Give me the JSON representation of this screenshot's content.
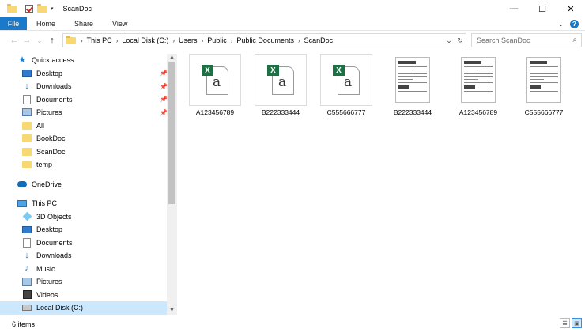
{
  "window": {
    "title": "ScanDoc",
    "controls": {
      "minimize": "—",
      "maximize": "☐",
      "close": "✕"
    }
  },
  "ribbon": {
    "file": "File",
    "tabs": [
      "Home",
      "Share",
      "View"
    ],
    "expand": "⌄",
    "help": "?"
  },
  "nav": {
    "back": "←",
    "forward": "→",
    "recent": "⌄",
    "up": "↑",
    "breadcrumb": [
      "This PC",
      "Local Disk (C:)",
      "Users",
      "Public",
      "Public Documents",
      "ScanDoc"
    ],
    "crumb_sep": "›",
    "dropdown": "⌄",
    "refresh": "↻"
  },
  "search": {
    "placeholder": "Search ScanDoc",
    "icon": "⌕"
  },
  "sidebar": {
    "quick_access": {
      "label": "Quick access",
      "items": [
        {
          "label": "Desktop",
          "icon": "desktop-icon",
          "pinned": true
        },
        {
          "label": "Downloads",
          "icon": "download-icon",
          "pinned": true
        },
        {
          "label": "Documents",
          "icon": "document-icon",
          "pinned": true
        },
        {
          "label": "Pictures",
          "icon": "pictures-icon",
          "pinned": true
        },
        {
          "label": "All",
          "icon": "folder-icon",
          "pinned": false
        },
        {
          "label": "BookDoc",
          "icon": "folder-icon",
          "pinned": false
        },
        {
          "label": "ScanDoc",
          "icon": "folder-icon",
          "pinned": false
        },
        {
          "label": "temp",
          "icon": "folder-icon",
          "pinned": false
        }
      ]
    },
    "onedrive": {
      "label": "OneDrive"
    },
    "this_pc": {
      "label": "This PC",
      "items": [
        {
          "label": "3D Objects",
          "icon": "cube-icon"
        },
        {
          "label": "Desktop",
          "icon": "desktop-icon"
        },
        {
          "label": "Documents",
          "icon": "document-icon"
        },
        {
          "label": "Downloads",
          "icon": "download-icon"
        },
        {
          "label": "Music",
          "icon": "music-icon"
        },
        {
          "label": "Pictures",
          "icon": "pictures-icon"
        },
        {
          "label": "Videos",
          "icon": "video-icon"
        },
        {
          "label": "Local Disk (C:)",
          "icon": "disk-icon",
          "selected": true
        }
      ]
    },
    "pin_glyph": "📌",
    "scroll_up": "▲",
    "scroll_down": "▼"
  },
  "files": [
    {
      "name": "A123456789",
      "type": "excel"
    },
    {
      "name": "B222333444",
      "type": "excel"
    },
    {
      "name": "C555666777",
      "type": "excel"
    },
    {
      "name": "B222333444",
      "type": "scan"
    },
    {
      "name": "A123456789",
      "type": "scan"
    },
    {
      "name": "C555666777",
      "type": "scan"
    }
  ],
  "excel_icon": {
    "badge": "X",
    "letter": "a"
  },
  "status": {
    "item_count": "6 items"
  },
  "colors": {
    "accent": "#1979ca",
    "selection": "#cce8ff",
    "excel_green": "#1d7044",
    "folder": "#f8d775"
  }
}
